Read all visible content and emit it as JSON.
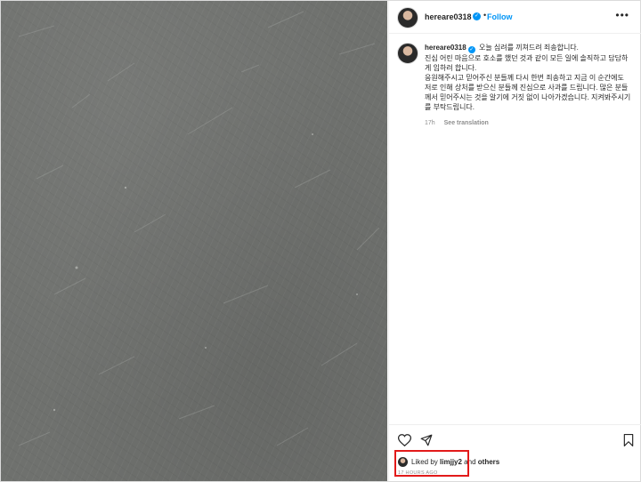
{
  "post": {
    "username": "hereare0318",
    "follow_label": "Follow",
    "more_label": "•••",
    "caption_lines": [
      "오늘 심려를 끼쳐드려 죄송합니다.",
      "진심 어린 마음으로 호소를 했던 것과 같이 모든 일에 솔직하고 담담하게 임하려 합니다.",
      "응원해주시고 믿어주신 분들께 다시 한번 죄송하고 지금 이 순간에도 저로 인해 상처를 받으신 분들께 진심으로 사과를 드립니다. 많은 분들께서 믿어주시는 것을 알기에 거짓 없이 나아가겠습니다. 지켜봐주시기를 부탁드립니다."
    ],
    "time_ago": "17h",
    "translation_label": "See translation",
    "liked_by_prefix": "Liked by",
    "liked_by_user": "limjjy2",
    "liked_by_and": "and",
    "liked_by_others": "others",
    "timestamp": "17 HOURS AGO"
  },
  "colors": {
    "accent": "#0095f6",
    "highlight_box": "#e21a1a",
    "photo_gray": "#6f716e"
  },
  "icons": [
    "heart-icon",
    "share-icon",
    "bookmark-icon",
    "verified-icon",
    "more-icon"
  ]
}
